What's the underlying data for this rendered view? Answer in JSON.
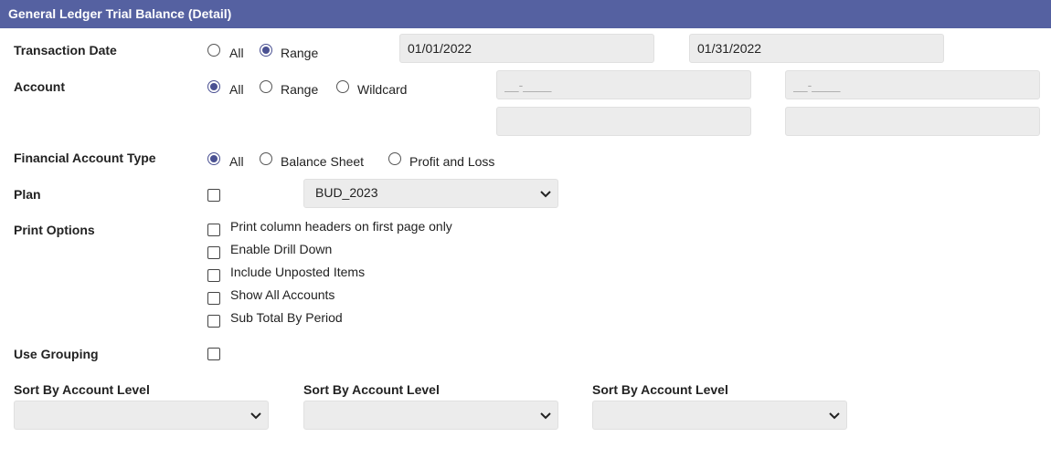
{
  "title": "General Ledger Trial Balance (Detail)",
  "transaction_date": {
    "label": "Transaction Date",
    "options": [
      "All",
      "Range"
    ],
    "selected": "Range",
    "from": "01/01/2022",
    "to": "01/31/2022"
  },
  "account": {
    "label": "Account",
    "options": [
      "All",
      "Range",
      "Wildcard"
    ],
    "selected": "All",
    "from_placeholder": "__-____",
    "to_placeholder": "__-____"
  },
  "financial_account_type": {
    "label": "Financial Account Type",
    "options": [
      "All",
      "Balance Sheet",
      "Profit and Loss"
    ],
    "selected": "All"
  },
  "plan": {
    "label": "Plan",
    "checked": false,
    "value": "BUD_2023"
  },
  "print_options": {
    "label": "Print Options",
    "items": [
      "Print column headers on first page only",
      "Enable Drill Down",
      "Include Unposted Items",
      "Show All Accounts",
      "Sub Total By Period"
    ]
  },
  "use_grouping": {
    "label": "Use Grouping",
    "checked": false
  },
  "sort_by": [
    {
      "label": "Sort By Account Level",
      "value": ""
    },
    {
      "label": "Sort By Account Level",
      "value": ""
    },
    {
      "label": "Sort By Account Level",
      "value": ""
    }
  ],
  "icons": {
    "dropdown": "chevron-down-icon"
  },
  "colors": {
    "header_bg": "#5561a1",
    "accent": "#4a5192",
    "field_bg": "#ececec"
  }
}
